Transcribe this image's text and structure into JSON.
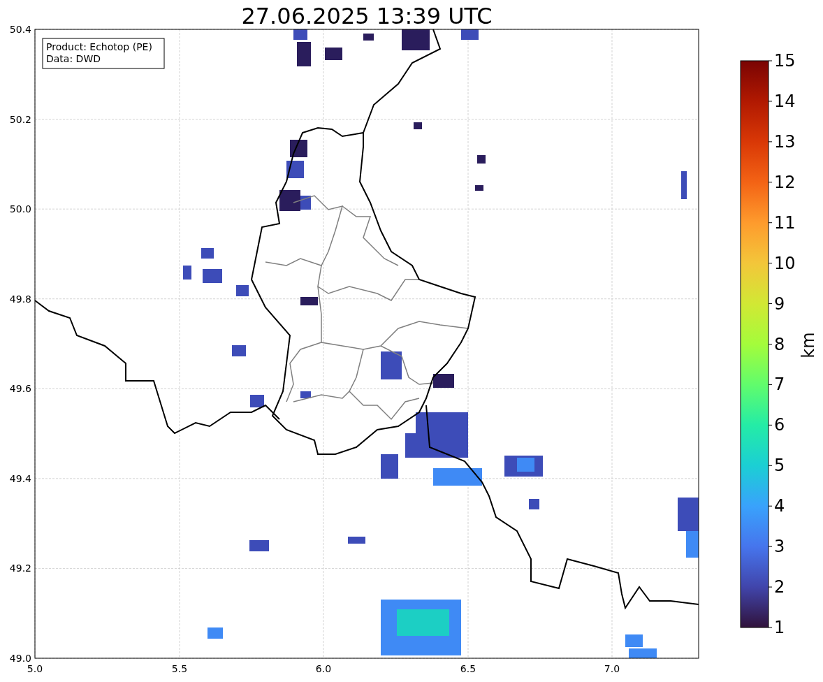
{
  "title": "27.06.2025 13:39 UTC",
  "info_box": [
    "Product: Echotop (PE)",
    "Data: DWD"
  ],
  "map": {
    "xticks": [
      "5.0",
      "5.5",
      "6.0",
      "6.5",
      "7.0"
    ],
    "yticks": [
      "50.4",
      "50.2",
      "50.0",
      "49.8",
      "49.6",
      "49.4",
      "49.2",
      "49.0"
    ]
  },
  "colorbar": {
    "label": "km",
    "ticks": [
      "15",
      "14",
      "13",
      "12",
      "11",
      "10",
      "9",
      "8",
      "7",
      "6",
      "5",
      "4",
      "3",
      "2",
      "1"
    ]
  }
}
